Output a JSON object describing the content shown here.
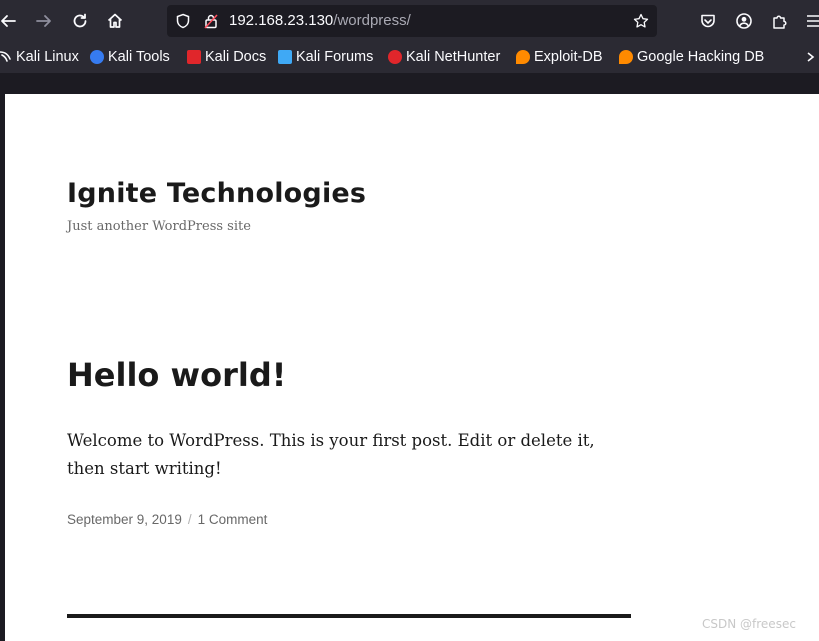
{
  "browser": {
    "url_host": "192.168.23.130",
    "url_path": "/wordpress/"
  },
  "bookmarks": [
    {
      "label": "Kali Linux",
      "icon": "kali-dragon-icon",
      "color": "#ffffff"
    },
    {
      "label": "Kali Tools",
      "icon": "kali-tools-icon",
      "color": "#367bf0"
    },
    {
      "label": "Kali Docs",
      "icon": "kali-docs-icon",
      "color": "#e0262b"
    },
    {
      "label": "Kali Forums",
      "icon": "kali-forums-icon",
      "color": "#3fa9f5"
    },
    {
      "label": "Kali NetHunter",
      "icon": "kali-nethunter-icon",
      "color": "#e0262b"
    },
    {
      "label": "Exploit-DB",
      "icon": "exploit-db-icon",
      "color": "#ff8a00"
    },
    {
      "label": "Google Hacking DB",
      "icon": "ghdb-icon",
      "color": "#ff8a00"
    }
  ],
  "site": {
    "title": "Ignite Technologies",
    "tagline": "Just another WordPress site"
  },
  "post": {
    "title": "Hello world!",
    "body": "Welcome to WordPress. This is your first post. Edit or delete it, then start writing!",
    "date": "September 9, 2019",
    "separator": "/",
    "comments": "1 Comment"
  },
  "watermark": "CSDN @freesec"
}
